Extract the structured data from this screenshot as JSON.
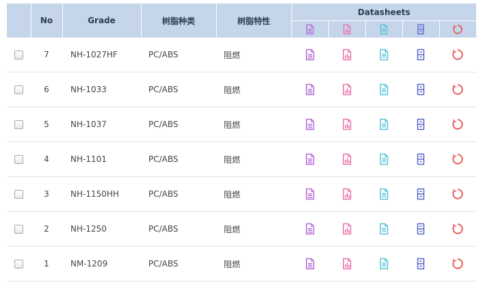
{
  "table": {
    "headers": {
      "no": "No",
      "grade": "Grade",
      "resin_type": "树脂种类",
      "resin_property": "树脂特性",
      "datasheets": "Datasheets"
    },
    "icon_colors": {
      "tds": "#b56ad6",
      "chart": "#ea6fa8",
      "doc": "#55c2d6",
      "cabinet": "#5865c7",
      "ring": "#e85c5c"
    },
    "rows": [
      {
        "no": "7",
        "grade": "NH-1027HF",
        "resin_type": "PC/ABS",
        "resin_property": "阻燃"
      },
      {
        "no": "6",
        "grade": "NH-1033",
        "resin_type": "PC/ABS",
        "resin_property": "阻燃"
      },
      {
        "no": "5",
        "grade": "NH-1037",
        "resin_type": "PC/ABS",
        "resin_property": "阻燃"
      },
      {
        "no": "4",
        "grade": "NH-1101",
        "resin_type": "PC/ABS",
        "resin_property": "阻燃"
      },
      {
        "no": "3",
        "grade": "NH-1150HH",
        "resin_type": "PC/ABS",
        "resin_property": "阻燃"
      },
      {
        "no": "2",
        "grade": "NH-1250",
        "resin_type": "PC/ABS",
        "resin_property": "阻燃"
      },
      {
        "no": "1",
        "grade": "NM-1209",
        "resin_type": "PC/ABS",
        "resin_property": "阻燃"
      }
    ]
  }
}
